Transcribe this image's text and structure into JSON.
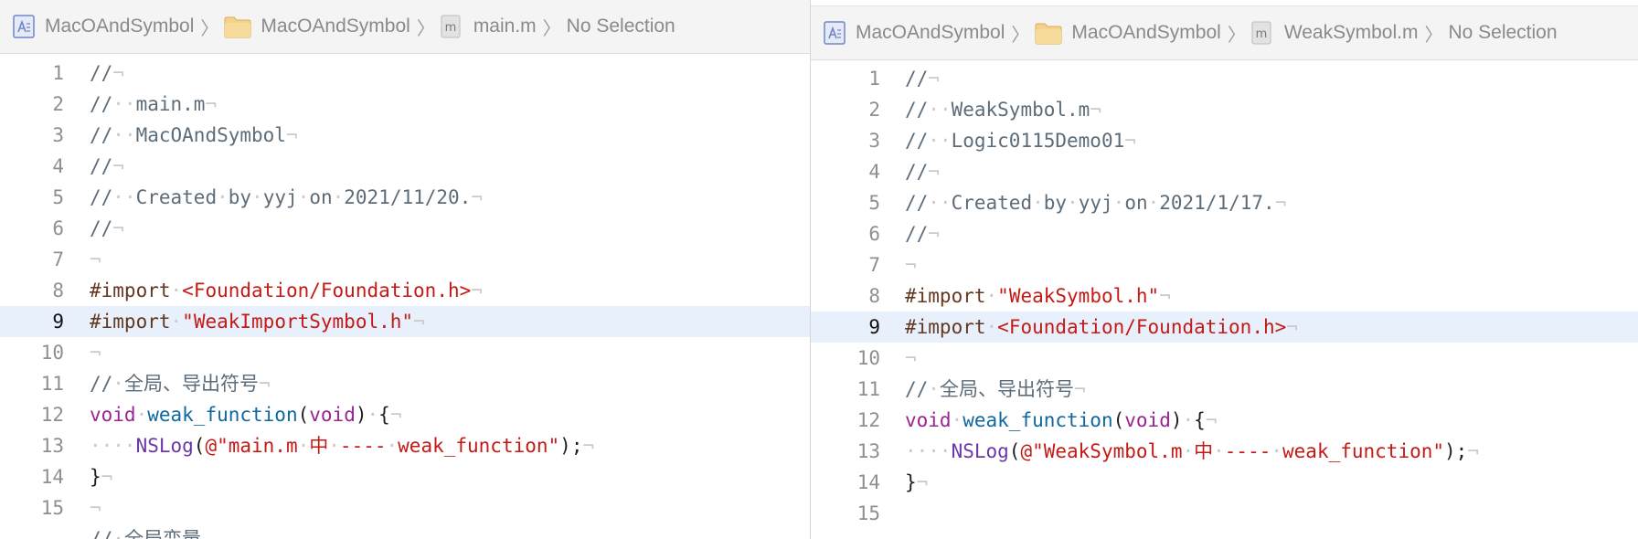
{
  "left": {
    "breadcrumb": {
      "project": "MacOAndSymbol",
      "folder": "MacOAndSymbol",
      "file": "main.m",
      "selection": "No Selection"
    },
    "lines": [
      {
        "num": "1",
        "tokens": [
          [
            "comment",
            "//"
          ],
          [
            "inv",
            "¬"
          ]
        ]
      },
      {
        "num": "2",
        "tokens": [
          [
            "comment",
            "//"
          ],
          [
            "inv",
            "··"
          ],
          [
            "comment",
            "main.m"
          ],
          [
            "inv",
            "¬"
          ]
        ]
      },
      {
        "num": "3",
        "tokens": [
          [
            "comment",
            "//"
          ],
          [
            "inv",
            "··"
          ],
          [
            "comment",
            "MacOAndSymbol"
          ],
          [
            "inv",
            "¬"
          ]
        ]
      },
      {
        "num": "4",
        "tokens": [
          [
            "comment",
            "//"
          ],
          [
            "inv",
            "¬"
          ]
        ]
      },
      {
        "num": "5",
        "tokens": [
          [
            "comment",
            "//"
          ],
          [
            "inv",
            "··"
          ],
          [
            "comment",
            "Created"
          ],
          [
            "inv",
            "·"
          ],
          [
            "comment",
            "by"
          ],
          [
            "inv",
            "·"
          ],
          [
            "comment",
            "yyj"
          ],
          [
            "inv",
            "·"
          ],
          [
            "comment",
            "on"
          ],
          [
            "inv",
            "·"
          ],
          [
            "comment",
            "2021/11/20."
          ],
          [
            "inv",
            "¬"
          ]
        ]
      },
      {
        "num": "6",
        "tokens": [
          [
            "comment",
            "//"
          ],
          [
            "inv",
            "¬"
          ]
        ]
      },
      {
        "num": "7",
        "tokens": [
          [
            "inv",
            "¬"
          ]
        ]
      },
      {
        "num": "8",
        "tokens": [
          [
            "pre",
            "#import"
          ],
          [
            "inv",
            "·"
          ],
          [
            "str",
            "<Foundation/Foundation.h>"
          ],
          [
            "inv",
            "¬"
          ]
        ]
      },
      {
        "num": "9",
        "current": true,
        "tokens": [
          [
            "pre",
            "#import"
          ],
          [
            "inv",
            "·"
          ],
          [
            "str",
            "\"WeakImportSymbol.h\""
          ],
          [
            "inv",
            "¬"
          ]
        ]
      },
      {
        "num": "10",
        "tokens": [
          [
            "inv",
            "¬"
          ]
        ]
      },
      {
        "num": "11",
        "tokens": [
          [
            "comment",
            "//"
          ],
          [
            "inv",
            "·"
          ],
          [
            "comment",
            "全局、导出符号"
          ],
          [
            "inv",
            "¬"
          ]
        ]
      },
      {
        "num": "12",
        "tokens": [
          [
            "kw",
            "void"
          ],
          [
            "inv",
            "·"
          ],
          [
            "fn",
            "weak_function"
          ],
          [
            "plain",
            "("
          ],
          [
            "kw",
            "void"
          ],
          [
            "plain",
            ")"
          ],
          [
            "inv",
            "·"
          ],
          [
            "plain",
            "{"
          ],
          [
            "inv",
            "¬"
          ]
        ]
      },
      {
        "num": "13",
        "tokens": [
          [
            "inv",
            "····"
          ],
          [
            "ns",
            "NSLog"
          ],
          [
            "plain",
            "("
          ],
          [
            "str",
            "@\"main.m"
          ],
          [
            "inv",
            "·"
          ],
          [
            "str",
            "中"
          ],
          [
            "inv",
            "·"
          ],
          [
            "str",
            "----"
          ],
          [
            "inv",
            "·"
          ],
          [
            "str",
            "weak_function\""
          ],
          [
            "plain",
            ");"
          ],
          [
            "inv",
            "¬"
          ]
        ]
      },
      {
        "num": "14",
        "tokens": [
          [
            "plain",
            "}"
          ],
          [
            "inv",
            "¬"
          ]
        ]
      },
      {
        "num": "15",
        "tokens": [
          [
            "inv",
            "¬"
          ]
        ]
      },
      {
        "num": "",
        "tokens": [
          [
            "comment",
            "//"
          ],
          [
            "inv",
            "·"
          ],
          [
            "comment",
            "全局变量"
          ]
        ]
      }
    ]
  },
  "right": {
    "breadcrumb": {
      "project": "MacOAndSymbol",
      "folder": "MacOAndSymbol",
      "file": "WeakSymbol.m",
      "selection": "No Selection"
    },
    "lines": [
      {
        "num": "1",
        "tokens": [
          [
            "comment",
            "//"
          ],
          [
            "inv",
            "¬"
          ]
        ]
      },
      {
        "num": "2",
        "tokens": [
          [
            "comment",
            "//"
          ],
          [
            "inv",
            "··"
          ],
          [
            "comment",
            "WeakSymbol.m"
          ],
          [
            "inv",
            "¬"
          ]
        ]
      },
      {
        "num": "3",
        "tokens": [
          [
            "comment",
            "//"
          ],
          [
            "inv",
            "··"
          ],
          [
            "comment",
            "Logic0115Demo01"
          ],
          [
            "inv",
            "¬"
          ]
        ]
      },
      {
        "num": "4",
        "tokens": [
          [
            "comment",
            "//"
          ],
          [
            "inv",
            "¬"
          ]
        ]
      },
      {
        "num": "5",
        "tokens": [
          [
            "comment",
            "//"
          ],
          [
            "inv",
            "··"
          ],
          [
            "comment",
            "Created"
          ],
          [
            "inv",
            "·"
          ],
          [
            "comment",
            "by"
          ],
          [
            "inv",
            "·"
          ],
          [
            "comment",
            "yyj"
          ],
          [
            "inv",
            "·"
          ],
          [
            "comment",
            "on"
          ],
          [
            "inv",
            "·"
          ],
          [
            "comment",
            "2021/1/17."
          ],
          [
            "inv",
            "¬"
          ]
        ]
      },
      {
        "num": "6",
        "tokens": [
          [
            "comment",
            "//"
          ],
          [
            "inv",
            "¬"
          ]
        ]
      },
      {
        "num": "7",
        "tokens": [
          [
            "inv",
            "¬"
          ]
        ]
      },
      {
        "num": "8",
        "tokens": [
          [
            "pre",
            "#import"
          ],
          [
            "inv",
            "·"
          ],
          [
            "str",
            "\"WeakSymbol.h\""
          ],
          [
            "inv",
            "¬"
          ]
        ]
      },
      {
        "num": "9",
        "current": true,
        "tokens": [
          [
            "pre",
            "#import"
          ],
          [
            "inv",
            "·"
          ],
          [
            "str",
            "<Foundation/Foundation.h>"
          ],
          [
            "inv",
            "¬"
          ]
        ]
      },
      {
        "num": "10",
        "tokens": [
          [
            "inv",
            "¬"
          ]
        ]
      },
      {
        "num": "11",
        "tokens": [
          [
            "comment",
            "//"
          ],
          [
            "inv",
            "·"
          ],
          [
            "comment",
            "全局、导出符号"
          ],
          [
            "inv",
            "¬"
          ]
        ]
      },
      {
        "num": "12",
        "tokens": [
          [
            "kw",
            "void"
          ],
          [
            "inv",
            "·"
          ],
          [
            "fn",
            "weak_function"
          ],
          [
            "plain",
            "("
          ],
          [
            "kw",
            "void"
          ],
          [
            "plain",
            ")"
          ],
          [
            "inv",
            "·"
          ],
          [
            "plain",
            "{"
          ],
          [
            "inv",
            "¬"
          ]
        ]
      },
      {
        "num": "13",
        "tokens": [
          [
            "inv",
            "····"
          ],
          [
            "ns",
            "NSLog"
          ],
          [
            "plain",
            "("
          ],
          [
            "str",
            "@\"WeakSymbol.m"
          ],
          [
            "inv",
            "·"
          ],
          [
            "str",
            "中"
          ],
          [
            "inv",
            "·"
          ],
          [
            "str",
            "----"
          ],
          [
            "inv",
            "·"
          ],
          [
            "str",
            "weak_function\""
          ],
          [
            "plain",
            ");"
          ],
          [
            "inv",
            "¬"
          ]
        ]
      },
      {
        "num": "14",
        "tokens": [
          [
            "plain",
            "}"
          ],
          [
            "inv",
            "¬"
          ]
        ]
      },
      {
        "num": "15",
        "tokens": []
      }
    ]
  },
  "icons": {
    "project": "xcodeproj-icon",
    "folder": "folder-icon",
    "file": "objc-m-file-icon",
    "separator": "chevron-right-icon"
  },
  "colors": {
    "comment": "#5d6c79",
    "preprocessor": "#643820",
    "string": "#c41a16",
    "keyword": "#9b2393",
    "function": "#0f68a0",
    "framework": "#6c36a9",
    "invisibles": "#c9c9c9",
    "current_line": "#e8f0fb"
  }
}
